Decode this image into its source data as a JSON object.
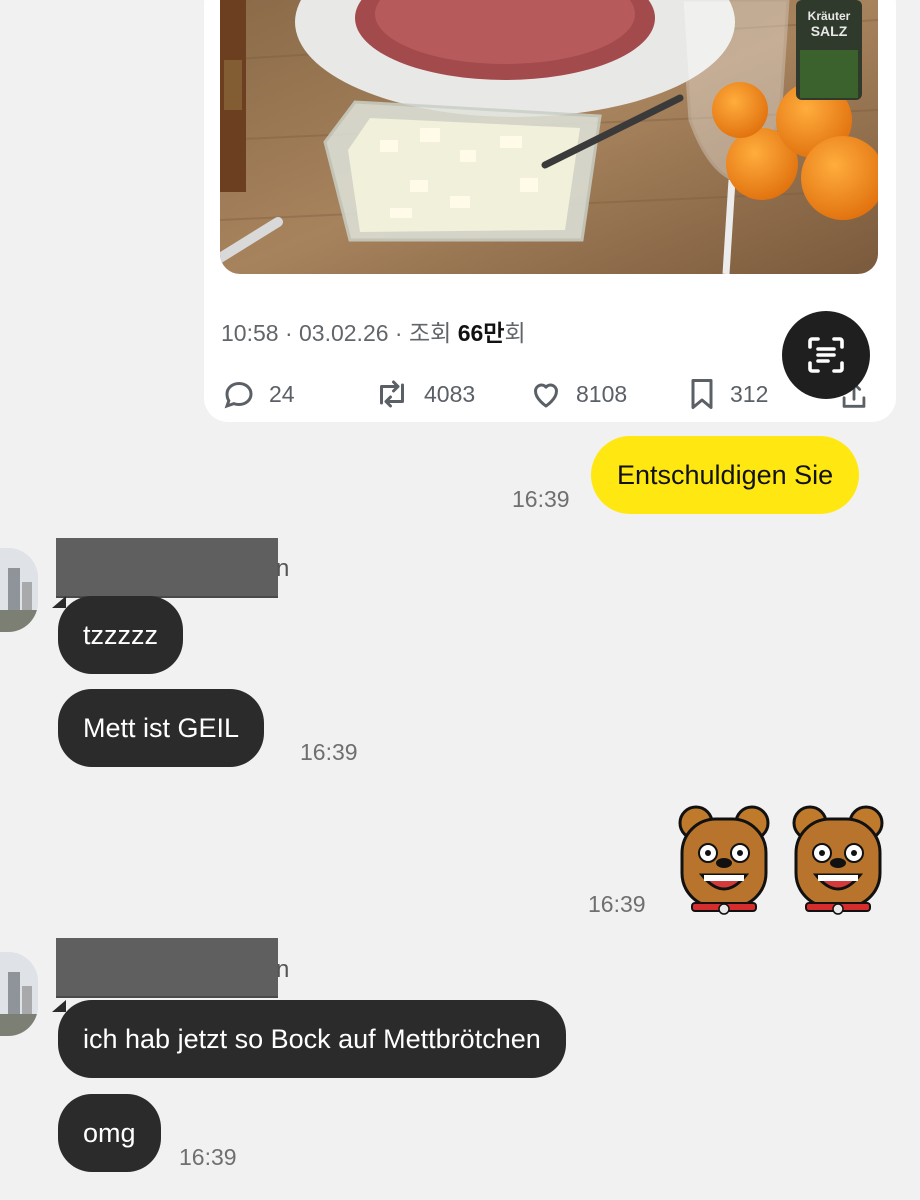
{
  "tweet": {
    "meta_prefix": "10:58 · 03.02.26 · 조회 ",
    "views_bold": "66만",
    "views_suffix": "회",
    "actions": {
      "replies": "24",
      "retweets": "4083",
      "likes": "8108",
      "bookmarks": "312"
    },
    "photo_label_line1": "Kräuter",
    "photo_label_line2": "SALZ"
  },
  "messages": {
    "m1": {
      "text": "Entschuldigen Sie",
      "time": "16:39"
    },
    "m2": {
      "lines": [
        "tzzzzz",
        "Mett ist GEIL"
      ],
      "time": "16:39",
      "name_tail": "n"
    },
    "m3": {
      "time": "16:39"
    },
    "m4": {
      "lines": [
        "ich hab jetzt so Bock auf Mettbrötchen",
        "omg"
      ],
      "time": "16:39",
      "name_tail": "n"
    }
  },
  "colors": {
    "background": "#f1f1f1",
    "outgoing_bubble": "#ffe812",
    "incoming_bubble": "#2b2b2b",
    "card": "#ffffff"
  }
}
